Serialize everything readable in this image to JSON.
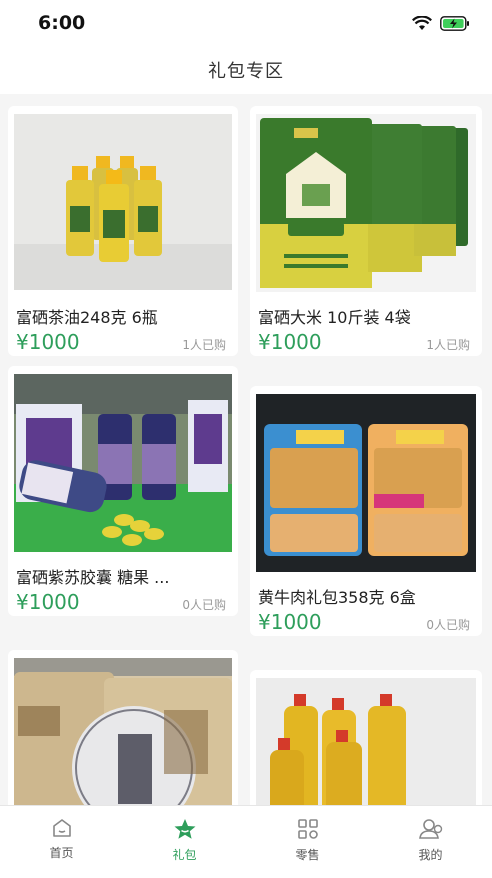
{
  "status_bar": {
    "time": "6:00"
  },
  "nav": {
    "title": "礼包专区"
  },
  "products": [
    {
      "name": "富硒茶油248克 6瓶",
      "price": "¥1000",
      "sold": "1人已购",
      "image": "tea-oil-bottles"
    },
    {
      "name": "富硒大米 10斤装 4袋",
      "price": "¥1000",
      "sold": "1人已购",
      "image": "rice-bags"
    },
    {
      "name": "富硒紫苏胶囊 糖果 ...",
      "price": "¥1000",
      "sold": "0人已购",
      "image": "perilla-capsules"
    },
    {
      "name": "黄牛肉礼包358克 6盒",
      "price": "¥1000",
      "sold": "0人已购",
      "image": "beef-boxes"
    },
    {
      "name": "",
      "price": "",
      "sold": "",
      "image": "tea-cake-bags"
    },
    {
      "name": "",
      "price": "",
      "sold": "",
      "image": "oil-bottles"
    }
  ],
  "tabbar": {
    "items": [
      {
        "label": "首页",
        "icon": "home-icon"
      },
      {
        "label": "礼包",
        "icon": "gift-star-icon"
      },
      {
        "label": "零售",
        "icon": "grid-icon"
      },
      {
        "label": "我的",
        "icon": "user-icon"
      }
    ],
    "active_index": 1
  },
  "colors": {
    "accent": "#2e9e5b",
    "background": "#f5f5f5",
    "muted": "#999999"
  }
}
